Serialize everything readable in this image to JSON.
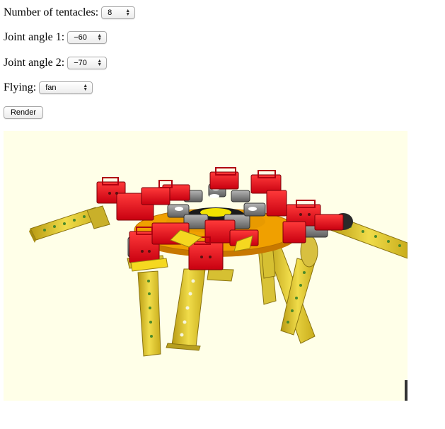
{
  "controls": {
    "tentacles": {
      "label": "Number of tentacles:",
      "value": "8"
    },
    "joint1": {
      "label": "Joint angle 1:",
      "value": "−60"
    },
    "joint2": {
      "label": "Joint angle 2:",
      "value": "−70"
    },
    "flying": {
      "label": "Flying:",
      "value": "fan"
    }
  },
  "render_button": {
    "label": "Render"
  },
  "viewport": {
    "background": "#ffffe8",
    "model": "3d-robot-octopus-render"
  },
  "colors": {
    "servo_red": "#e8121a",
    "arm_yellow": "#e6cf2e",
    "hub_orange": "#f0a000",
    "servo_grey": "#8a8a8a"
  }
}
